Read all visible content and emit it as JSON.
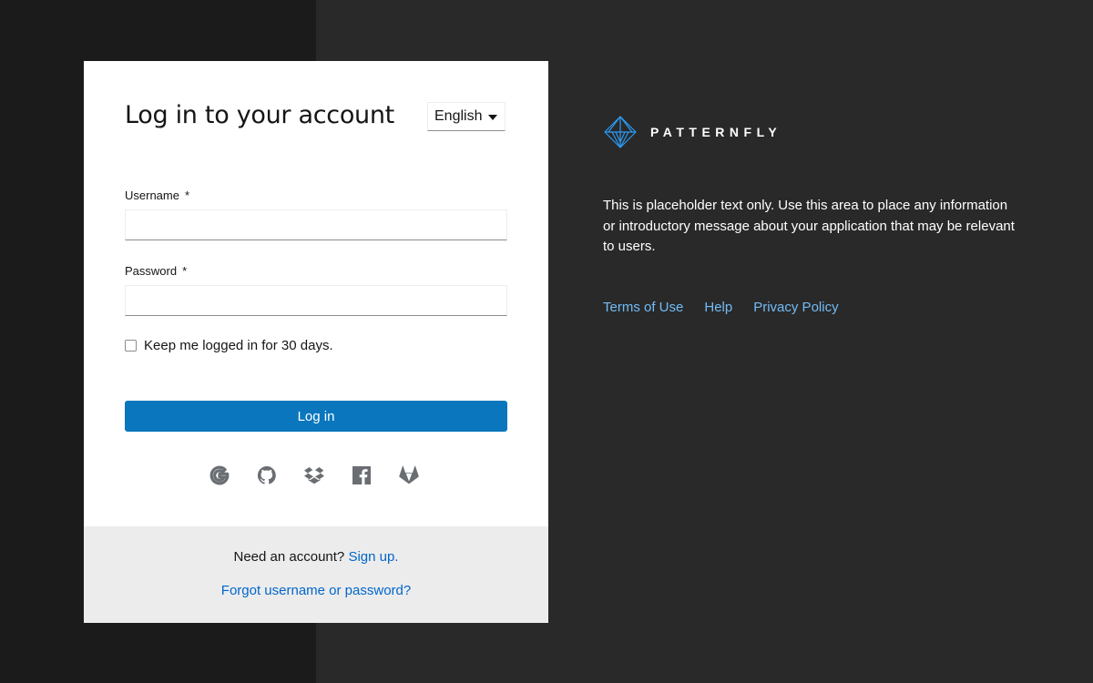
{
  "login": {
    "title": "Log in to your account",
    "language": "English",
    "username_label": "Username",
    "password_label": "Password",
    "required_mark": "*",
    "username_value": "",
    "password_value": "",
    "remember_label": "Keep me logged in for 30 days.",
    "remember_checked": false,
    "submit_label": "Log in",
    "social_providers": [
      "google-icon",
      "github-icon",
      "dropbox-icon",
      "facebook-icon",
      "gitlab-icon"
    ],
    "signup_prompt": "Need an account?",
    "signup_link": "Sign up.",
    "forgot_link": "Forgot username or password?"
  },
  "brand": {
    "name": "PATTERNFLY",
    "icon": "patternfly-logo-icon"
  },
  "info": {
    "text": "This is placeholder text only. Use this area to place any information or introductory message about your application that may be relevant to users.",
    "links": [
      "Terms of Use",
      "Help",
      "Privacy Policy"
    ]
  },
  "colors": {
    "page_background": "#292929",
    "left_band": "#1b1b1b",
    "primary_button": "#0a76bd",
    "link": "#0066cc",
    "dark_link": "#73bcf7",
    "footer_background": "#ececec"
  }
}
